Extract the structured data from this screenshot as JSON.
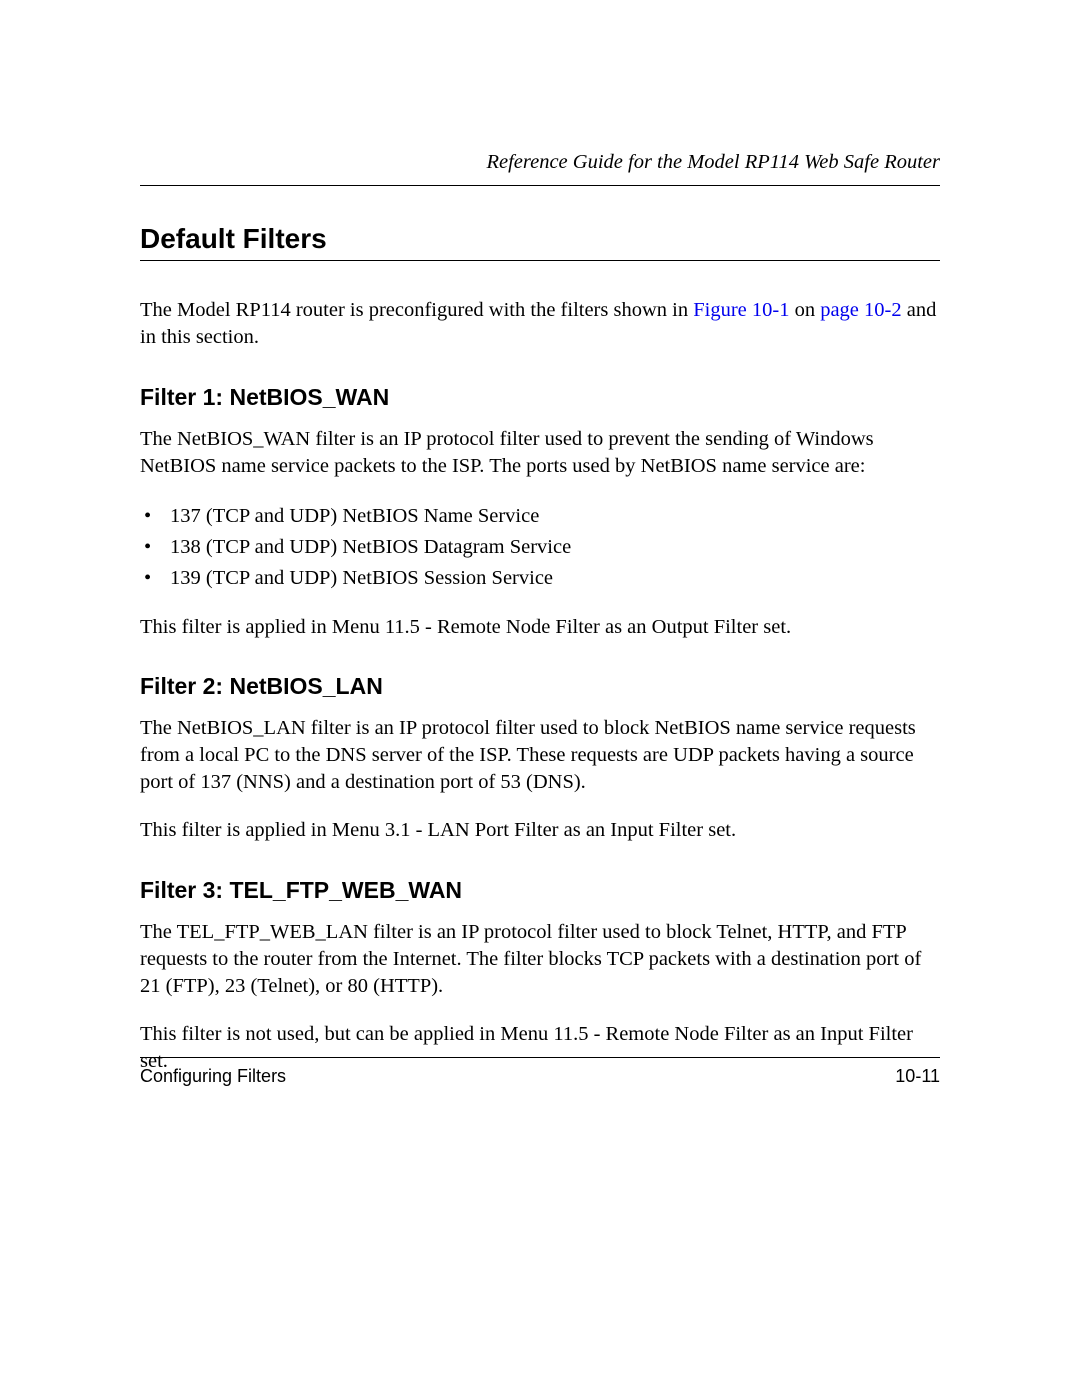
{
  "header": {
    "running_title": "Reference Guide for the Model RP114 Web Safe Router"
  },
  "section": {
    "title": "Default Filters",
    "intro_pre": "The Model RP114 router is preconfigured with the filters shown in ",
    "intro_link1": "Figure 10-1",
    "intro_mid": " on ",
    "intro_link2": "page 10-2",
    "intro_post": " and in this section."
  },
  "filters": [
    {
      "heading": "Filter 1: NetBIOS_WAN",
      "para1": "The NetBIOS_WAN filter is an IP protocol filter used to prevent the sending of Windows NetBIOS name service packets to the ISP. The ports used by NetBIOS name service are:",
      "bullets": [
        "137 (TCP and UDP) NetBIOS Name Service",
        "138 (TCP and UDP) NetBIOS Datagram Service",
        "139 (TCP and UDP) NetBIOS Session Service"
      ],
      "para2": "This filter is applied in Menu 11.5 - Remote Node Filter as an Output Filter set."
    },
    {
      "heading": "Filter 2: NetBIOS_LAN",
      "para1": "The NetBIOS_LAN filter is an IP protocol filter used to block NetBIOS name service requests from a local PC to the DNS server of the ISP. These requests are UDP packets having a source port of 137 (NNS) and a destination port of 53 (DNS).",
      "para2": "This filter is applied in Menu 3.1 - LAN Port Filter as an Input Filter set."
    },
    {
      "heading": "Filter 3: TEL_FTP_WEB_WAN",
      "para1": "The TEL_FTP_WEB_LAN filter is an IP protocol filter used to block Telnet, HTTP, and FTP requests to the router from the Internet. The filter blocks TCP packets with a destination port of 21 (FTP), 23 (Telnet), or 80 (HTTP).",
      "para2": "This filter is not used, but can be applied in Menu 11.5 - Remote Node Filter as an Input Filter set."
    }
  ],
  "footer": {
    "chapter": "Configuring Filters",
    "page_number": "10-11"
  }
}
